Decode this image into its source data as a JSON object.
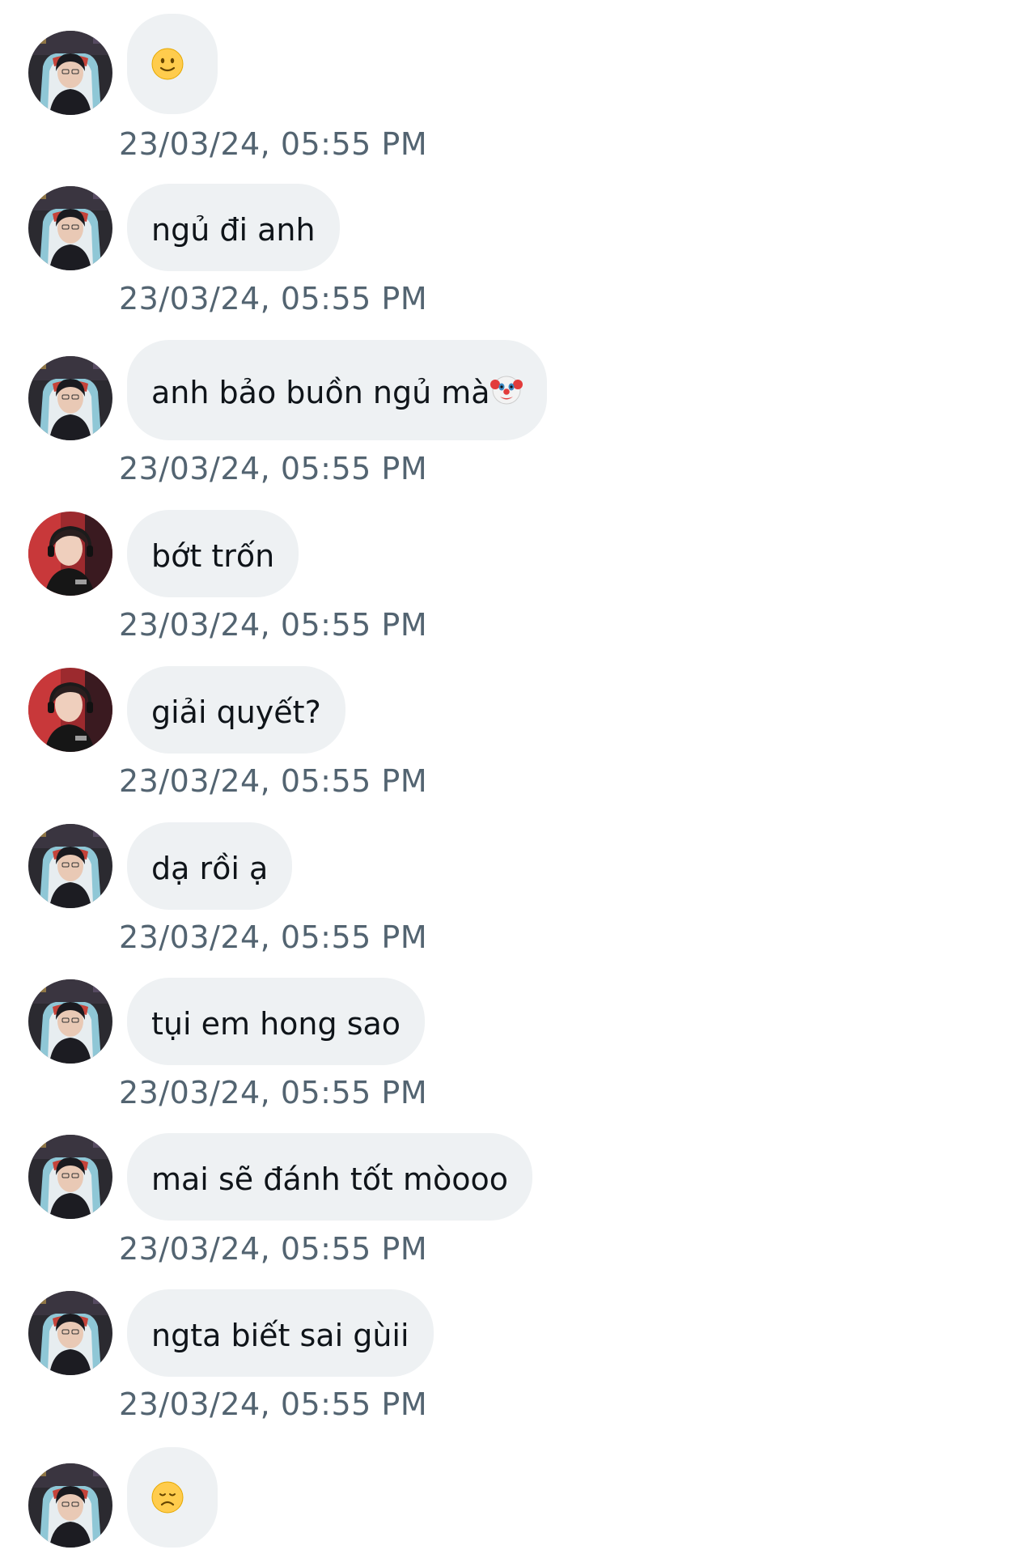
{
  "thread": {
    "messages": [
      {
        "id": "m1",
        "sender": "a",
        "text": "",
        "emoji": "slightly-smiling-face-icon",
        "timestamp": "23/03/24, 05:55 PM"
      },
      {
        "id": "m2",
        "sender": "a",
        "text": "ngủ đi anh",
        "emoji": "",
        "timestamp": "23/03/24, 05:55 PM"
      },
      {
        "id": "m3",
        "sender": "a",
        "text": "anh bảo buồn ngủ mà",
        "emoji": "clown-face-icon",
        "timestamp": "23/03/24, 05:55 PM"
      },
      {
        "id": "m4",
        "sender": "b",
        "text": "bớt trốn",
        "emoji": "",
        "timestamp": "23/03/24, 05:55 PM"
      },
      {
        "id": "m5",
        "sender": "b",
        "text": "giải quyết?",
        "emoji": "",
        "timestamp": "23/03/24, 05:55 PM"
      },
      {
        "id": "m6",
        "sender": "a",
        "text": "dạ rồi ạ",
        "emoji": "",
        "timestamp": "23/03/24, 05:55 PM"
      },
      {
        "id": "m7",
        "sender": "a",
        "text": "tụi em hong sao",
        "emoji": "",
        "timestamp": "23/03/24, 05:55 PM"
      },
      {
        "id": "m8",
        "sender": "a",
        "text": "mai sẽ đánh tốt mòooo",
        "emoji": "",
        "timestamp": "23/03/24, 05:55 PM"
      },
      {
        "id": "m9",
        "sender": "a",
        "text": "ngta biết sai gùii",
        "emoji": "",
        "timestamp": "23/03/24, 05:55 PM"
      },
      {
        "id": "m10",
        "sender": "a",
        "text": "",
        "emoji": "disappointed-face-icon",
        "timestamp": ""
      }
    ]
  },
  "colors": {
    "bubble_bg": "#eef1f3",
    "text": "#0f1419",
    "timestamp": "#536471",
    "background": "#ffffff"
  }
}
